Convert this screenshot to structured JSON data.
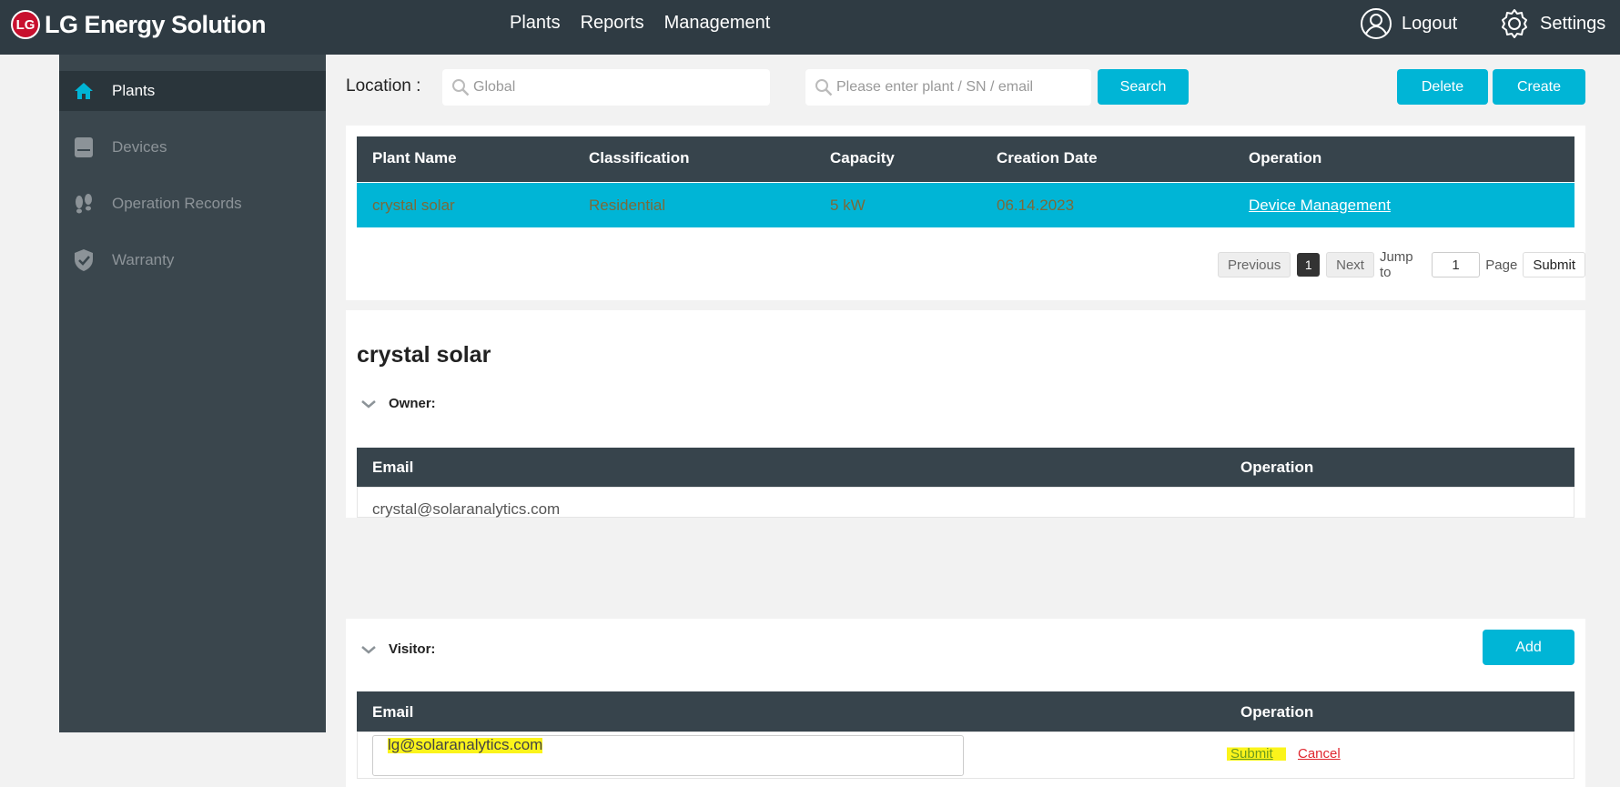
{
  "app": {
    "logo_text": "LG Energy Solution",
    "logo_mark": "LG"
  },
  "nav": {
    "items": [
      "Plants",
      "Reports",
      "Management"
    ]
  },
  "top_actions": {
    "logout": "Logout",
    "settings": "Settings"
  },
  "sidebar": {
    "items": [
      {
        "label": "Plants",
        "icon": "home-icon",
        "active": true
      },
      {
        "label": "Devices",
        "icon": "device-icon",
        "active": false
      },
      {
        "label": "Operation Records",
        "icon": "footprints-icon",
        "active": false
      },
      {
        "label": "Warranty",
        "icon": "shield-icon",
        "active": false
      }
    ]
  },
  "filters": {
    "location_label": "Location :",
    "location_placeholder": "Global",
    "search_placeholder": "Please enter plant / SN / email",
    "search_button": "Search",
    "delete_button": "Delete",
    "create_button": "Create"
  },
  "plants_table": {
    "headers": [
      "Plant Name",
      "Classification",
      "Capacity",
      "Creation Date",
      "Operation"
    ],
    "rows": [
      {
        "name": "crystal solar",
        "classification": "Residential",
        "capacity": "5 kW",
        "date": "06.14.2023",
        "operation": "Device Management"
      }
    ]
  },
  "pagination": {
    "previous": "Previous",
    "current": "1",
    "next": "Next",
    "jump_to": "Jump to",
    "jump_value": "1",
    "page": "Page",
    "submit": "Submit"
  },
  "plant_detail": {
    "title": "crystal solar",
    "owner": {
      "label": "Owner:",
      "headers": [
        "Email",
        "Operation"
      ],
      "rows": [
        {
          "email": "crystal@solaranalytics.com"
        }
      ]
    },
    "visitor": {
      "label": "Visitor:",
      "add_button": "Add",
      "headers": [
        "Email",
        "Operation"
      ],
      "input_value": "lg@solaranalytics.com",
      "submit": "Submit",
      "cancel": "Cancel"
    }
  },
  "colors": {
    "topbar": "#2f3b43",
    "sidebar": "#3a464d",
    "accent": "#00b5d6",
    "table_header": "#37444c",
    "highlight": "#fbf41b",
    "cancel": "#e0262e",
    "submit_link": "#6a9a1f"
  }
}
